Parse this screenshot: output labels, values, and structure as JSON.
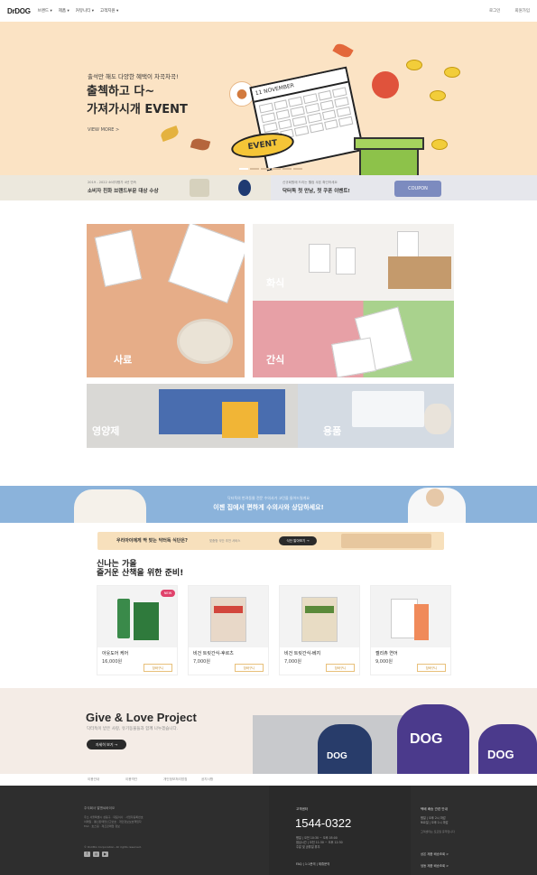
{
  "header": {
    "logo": "DrDOG",
    "nav": [
      "브랜드 ▾",
      "제품 ▾",
      "커뮤니티 ▾",
      "고객지원 ▾"
    ],
    "login": "로그인",
    "join": "회원가입"
  },
  "hero": {
    "subtitle": "출석만 해도 다양한 혜택이 차곡차곡!",
    "title_line1": "출첵하고 다~",
    "title_line2": "가져가시개 EVENT",
    "more": "VIEW MORE  >",
    "calendar_label": "11 NOVEMBER",
    "badge": "EVENT"
  },
  "award_strip": {
    "left_small": "2019 - 2022 소비자평가 4년 연속",
    "left_big": "소비자 친화 브랜드부문 대상 수상",
    "right_small": "신규회원에 드리는 웰컴 쿠폰 확인하세요",
    "right_big": "닥터독 첫 만남, 첫 쿠폰 이벤트!",
    "coupon": "COUPON"
  },
  "categories": {
    "food": "사료",
    "meal": "화식",
    "snack": "간식",
    "supplement": "영양제",
    "goods": "용품"
  },
  "consult": {
    "small": "닥터독의 반려동물 전문 수의사가 고민을 들어드릴게요",
    "big": "이젠 집에서 편하게 수의사와 상담하세요!"
  },
  "diet": {
    "text": "우리아이에게 딱 맞는 닥터독 식단은?",
    "sub": "맞춤형 식단 추천 서비스",
    "button": "식단 알아보기 →"
  },
  "walk": {
    "title_line1": "신나는 가을",
    "title_line2": "즐거운 산책을 위한 준비!",
    "products": [
      {
        "name": "아웃도어 케어",
        "price": "16,000원",
        "cart": "장바구니",
        "badge": "NEW"
      },
      {
        "name": "비건 트릿간식-후르츠",
        "price": "7,000원",
        "cart": "장바구니",
        "badge": ""
      },
      {
        "name": "비건 트릿간식-베지",
        "price": "7,000원",
        "cart": "장바구니",
        "badge": ""
      },
      {
        "name": "젤리츄 연어",
        "price": "9,000원",
        "cart": "장바구니",
        "badge": ""
      }
    ]
  },
  "give": {
    "title": "Give & Love Project",
    "sub": "닥터독이 받은 사랑, 유기동물들과 함께 나누겠습니다.",
    "button": "자세히 보기 →"
  },
  "footer_links": [
    "이용안내",
    "이용약관",
    "개인정보처리방침",
    "공지사항"
  ],
  "footer": {
    "company": "주식회사 알앤씨바이오",
    "info_lines": [
      "주소 서울특별시 성동구 · 대표이사 · 사업자등록번호",
      "이메일 · 통신판매업신고번호 · 개인정보보호책임자",
      "FAX · 호스팅 · 제조판매업 정보"
    ],
    "copyright": "© RnCBio Corporation. All rights reserved.",
    "cs_title": "고객센터",
    "phone": "1544-0322",
    "hours": [
      "평일 | 오전 10:30 ~ 오후 05:00",
      "점심시간 | 오전 11:30 ~ 오후 12:30",
      "주말 및 공휴일 휴무"
    ],
    "cs_small": "FAQ | 1:1문의 | 제휴문의",
    "delivery_title": "택배 배송 관련 안내",
    "delivery_hours": [
      "평일 | 오후 2시 마감",
      "토요일 | 오후 1시 마감"
    ],
    "delivery_small": "고객센터는 토요일 휴무입니다",
    "link1": "상온 제품 배송조회 >",
    "link2": "냉동 제품 배송조회 >"
  },
  "colors": {
    "hero_bg": "#fbe3c4",
    "consult_bg": "#8bb3db",
    "footer_bg": "#2e2e2e",
    "accent": "#f5c537"
  }
}
